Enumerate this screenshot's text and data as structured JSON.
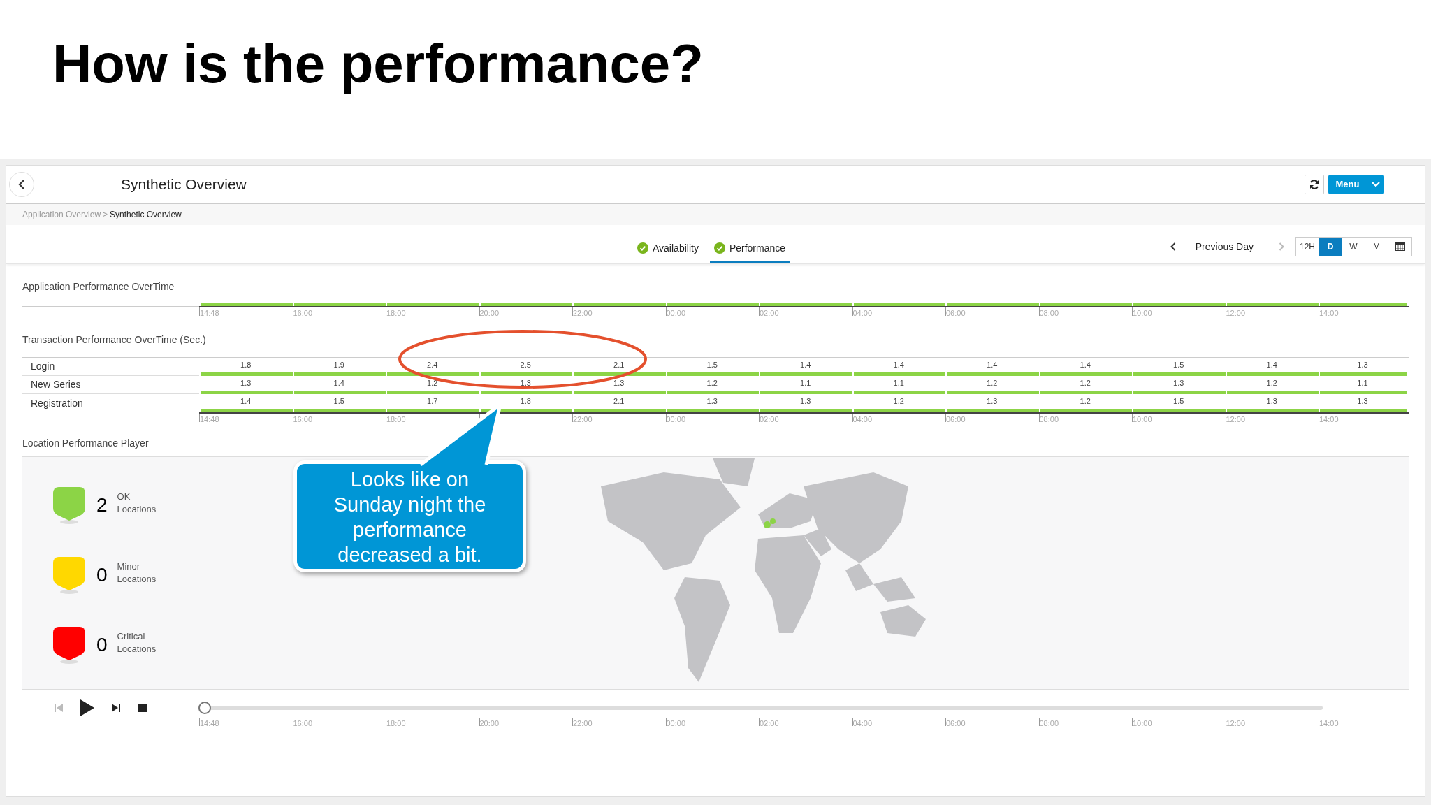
{
  "slide_title": "How is the performance?",
  "app": {
    "title": "Synthetic Overview",
    "breadcrumb": [
      {
        "label": "Application Overview",
        "current": false
      },
      {
        "label": "Synthetic Overview",
        "current": true
      }
    ],
    "breadcrumb_separator": ">",
    "menu_button": "Menu",
    "tabs": [
      {
        "label": "Availability",
        "selected": false
      },
      {
        "label": "Performance",
        "selected": true
      }
    ],
    "period_nav": {
      "label": "Previous Day"
    },
    "ranges": [
      {
        "label": "12H",
        "selected": false
      },
      {
        "label": "D",
        "selected": true
      },
      {
        "label": "W",
        "selected": false
      },
      {
        "label": "M",
        "selected": false
      }
    ],
    "application_performance": {
      "title": "Application Performance OverTime",
      "time_labels": [
        "14:48",
        "16:00",
        "18:00",
        "20:00",
        "22:00",
        "00:00",
        "02:00",
        "04:00",
        "06:00",
        "08:00",
        "10:00",
        "12:00",
        "14:00"
      ]
    },
    "transaction_performance": {
      "title": "Transaction Performance OverTime (Sec.)",
      "rows": [
        {
          "name": "Login",
          "values": [
            "1.8",
            "1.9",
            "2.4",
            "2.5",
            "2.1",
            "1.5",
            "1.4",
            "1.4",
            "1.4",
            "1.4",
            "1.5",
            "1.4",
            "1.3"
          ]
        },
        {
          "name": "New Series",
          "values": [
            "1.3",
            "1.4",
            "1.2",
            "1.3",
            "1.3",
            "1.2",
            "1.1",
            "1.1",
            "1.2",
            "1.2",
            "1.3",
            "1.2",
            "1.1"
          ]
        },
        {
          "name": "Registration",
          "values": [
            "1.4",
            "1.5",
            "1.7",
            "1.8",
            "2.1",
            "1.3",
            "1.3",
            "1.2",
            "1.3",
            "1.2",
            "1.5",
            "1.3",
            "1.3"
          ]
        }
      ],
      "time_labels_left": [
        "14:48",
        "16:00",
        "18:00"
      ],
      "time_labels_right": [
        "22:00",
        "00:00",
        "02:00",
        "04:00",
        "06:00",
        "08:00",
        "10:00",
        "12:00",
        "14:00"
      ]
    },
    "location_player": {
      "title": "Location Performance Player",
      "statuses": [
        {
          "count": "2",
          "label": "OK",
          "sublabel": "Locations",
          "color": "#8cd446"
        },
        {
          "count": "0",
          "label": "Minor",
          "sublabel": "Locations",
          "color": "#ffd800"
        },
        {
          "count": "0",
          "label": "Critical",
          "sublabel": "Locations",
          "color": "#ff0000"
        }
      ]
    },
    "player": {
      "level": 0,
      "time_labels": [
        "14:48",
        "16:00",
        "18:00",
        "20:00",
        "22:00",
        "00:00",
        "02:00",
        "04:00",
        "06:00",
        "08:00",
        "10:00",
        "12:00",
        "14:00"
      ]
    }
  },
  "callout": {
    "text": "Looks like on Sunday night the performance decreased a bit."
  }
}
